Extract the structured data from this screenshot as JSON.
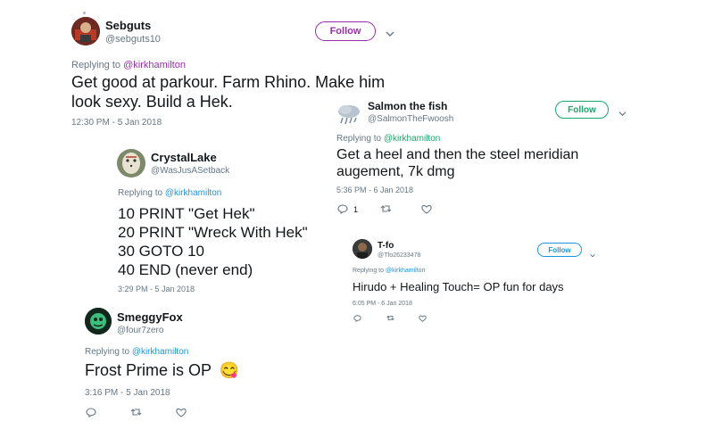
{
  "tweets": {
    "sebguts": {
      "name": "Sebguts",
      "handle": "@sebguts10",
      "follow_label": "Follow",
      "follow_color": "#9a2bb0",
      "replying_prefix": "Replying to",
      "mention": "@kirkhamilton",
      "text_line1": "Get good at parkour. Farm Rhino. Make him",
      "text_line2": "look sexy. Build a Hek.",
      "time": "12:30 PM - 5 Jan 2018"
    },
    "salmon": {
      "name": "Salmon the fish",
      "handle": "@SalmonTheFwoosh",
      "follow_label": "Follow",
      "follow_color": "#19a66b",
      "replying_prefix": "Replying to",
      "mention": "@kirkhamilton",
      "text_line1": "Get a heel and then the steel meridian",
      "text_line2": "augement, 7k dmg",
      "time": "5:36 PM - 6 Jan 2018",
      "reply_count": "1"
    },
    "crystal": {
      "name": "CrystalLake",
      "handle": "@WasJusASetback",
      "replying_prefix": "Replying to",
      "mention": "@kirkhamilton",
      "lines": [
        "10 PRINT \"Get Hek\"",
        "20 PRINT \"Wreck With Hek\"",
        "30 GOTO 10",
        "40 END (never end)"
      ],
      "time": "3:29 PM - 5 Jan 2018"
    },
    "tfo": {
      "name": "T-fo",
      "handle": "@Tfo26233478",
      "follow_label": "Follow",
      "follow_color": "#1b95e0",
      "replying_prefix": "Replying to",
      "mention": "@kirkhamilton",
      "text": "Hirudo + Healing Touch= OP fun for days",
      "time": "6:05 PM - 6 Jan 2018"
    },
    "smeggy": {
      "name": "SmeggyFox",
      "handle": "@four7zero",
      "replying_prefix": "Replying to",
      "mention": "@kirkhamilton",
      "text": "Frost Prime is OP",
      "emoji": "😋",
      "time": "3:16 PM - 5 Jan 2018"
    }
  },
  "icons": {
    "reply": "reply-icon",
    "retweet": "retweet-icon",
    "like": "heart-icon",
    "caret": "chevron-down-icon"
  }
}
